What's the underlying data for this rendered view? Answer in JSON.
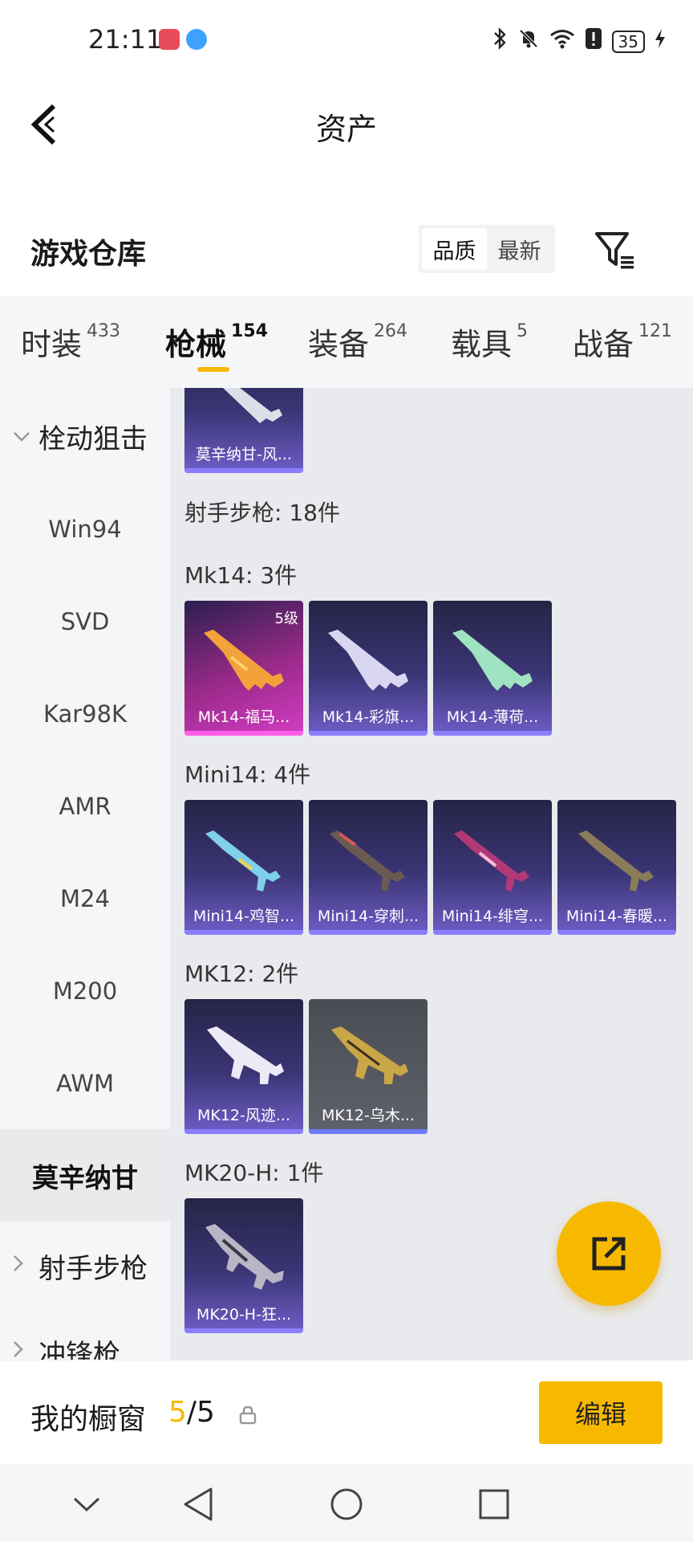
{
  "status_bar": {
    "time": "21:11",
    "battery": "35"
  },
  "header": {
    "title": "资产"
  },
  "warehouse": {
    "title": "游戏仓库",
    "sort_options": [
      "品质",
      "最新"
    ],
    "active_sort": "品质"
  },
  "tabs": [
    {
      "label": "时装",
      "count": "433"
    },
    {
      "label": "枪械",
      "count": "154",
      "active": true
    },
    {
      "label": "装备",
      "count": "264"
    },
    {
      "label": "载具",
      "count": "5"
    },
    {
      "label": "战备",
      "count": "121"
    }
  ],
  "side_nav": {
    "group_1": "栓动狙击",
    "items": [
      "Win94",
      "SVD",
      "Kar98K",
      "AMR",
      "M24",
      "M200",
      "AWM"
    ],
    "active_item": "莫辛纳甘",
    "group_2": "射手步枪",
    "group_3_partial": "冲锋枪"
  },
  "main": {
    "top_card_caption": "莫辛纳甘-风...",
    "category_header": "射手步枪: 18件",
    "sections": [
      {
        "title": "Mk14: 3件",
        "cards": [
          {
            "caption": "Mk14-福马...",
            "level": "5级",
            "style": "gold"
          },
          {
            "caption": "Mk14-彩旗...",
            "style": "purple"
          },
          {
            "caption": "Mk14-薄荷...",
            "style": "purple"
          }
        ]
      },
      {
        "title": "Mini14: 4件",
        "cards": [
          {
            "caption": "Mini14-鸡智...",
            "style": "purple"
          },
          {
            "caption": "Mini14-穿刺...",
            "style": "purple"
          },
          {
            "caption": "Mini14-绯穹...",
            "style": "purple"
          },
          {
            "caption": "Mini14-春暖...",
            "style": "purple"
          }
        ]
      },
      {
        "title": "MK12: 2件",
        "cards": [
          {
            "caption": "MK12-风迹...",
            "style": "purple"
          },
          {
            "caption": "MK12-乌木...",
            "style": "grey"
          }
        ]
      },
      {
        "title": "MK20-H: 1件",
        "cards": [
          {
            "caption": "MK20-H-狂...",
            "style": "purple"
          }
        ]
      }
    ]
  },
  "showcase": {
    "title": "我的橱窗",
    "current": "5",
    "separator_total": "/5",
    "edit_label": "编辑"
  },
  "colors": {
    "accent": "#f7b900",
    "purple_card": "#3b3575",
    "gold_card": "#d43dc4",
    "grey_card": "#60626b"
  }
}
